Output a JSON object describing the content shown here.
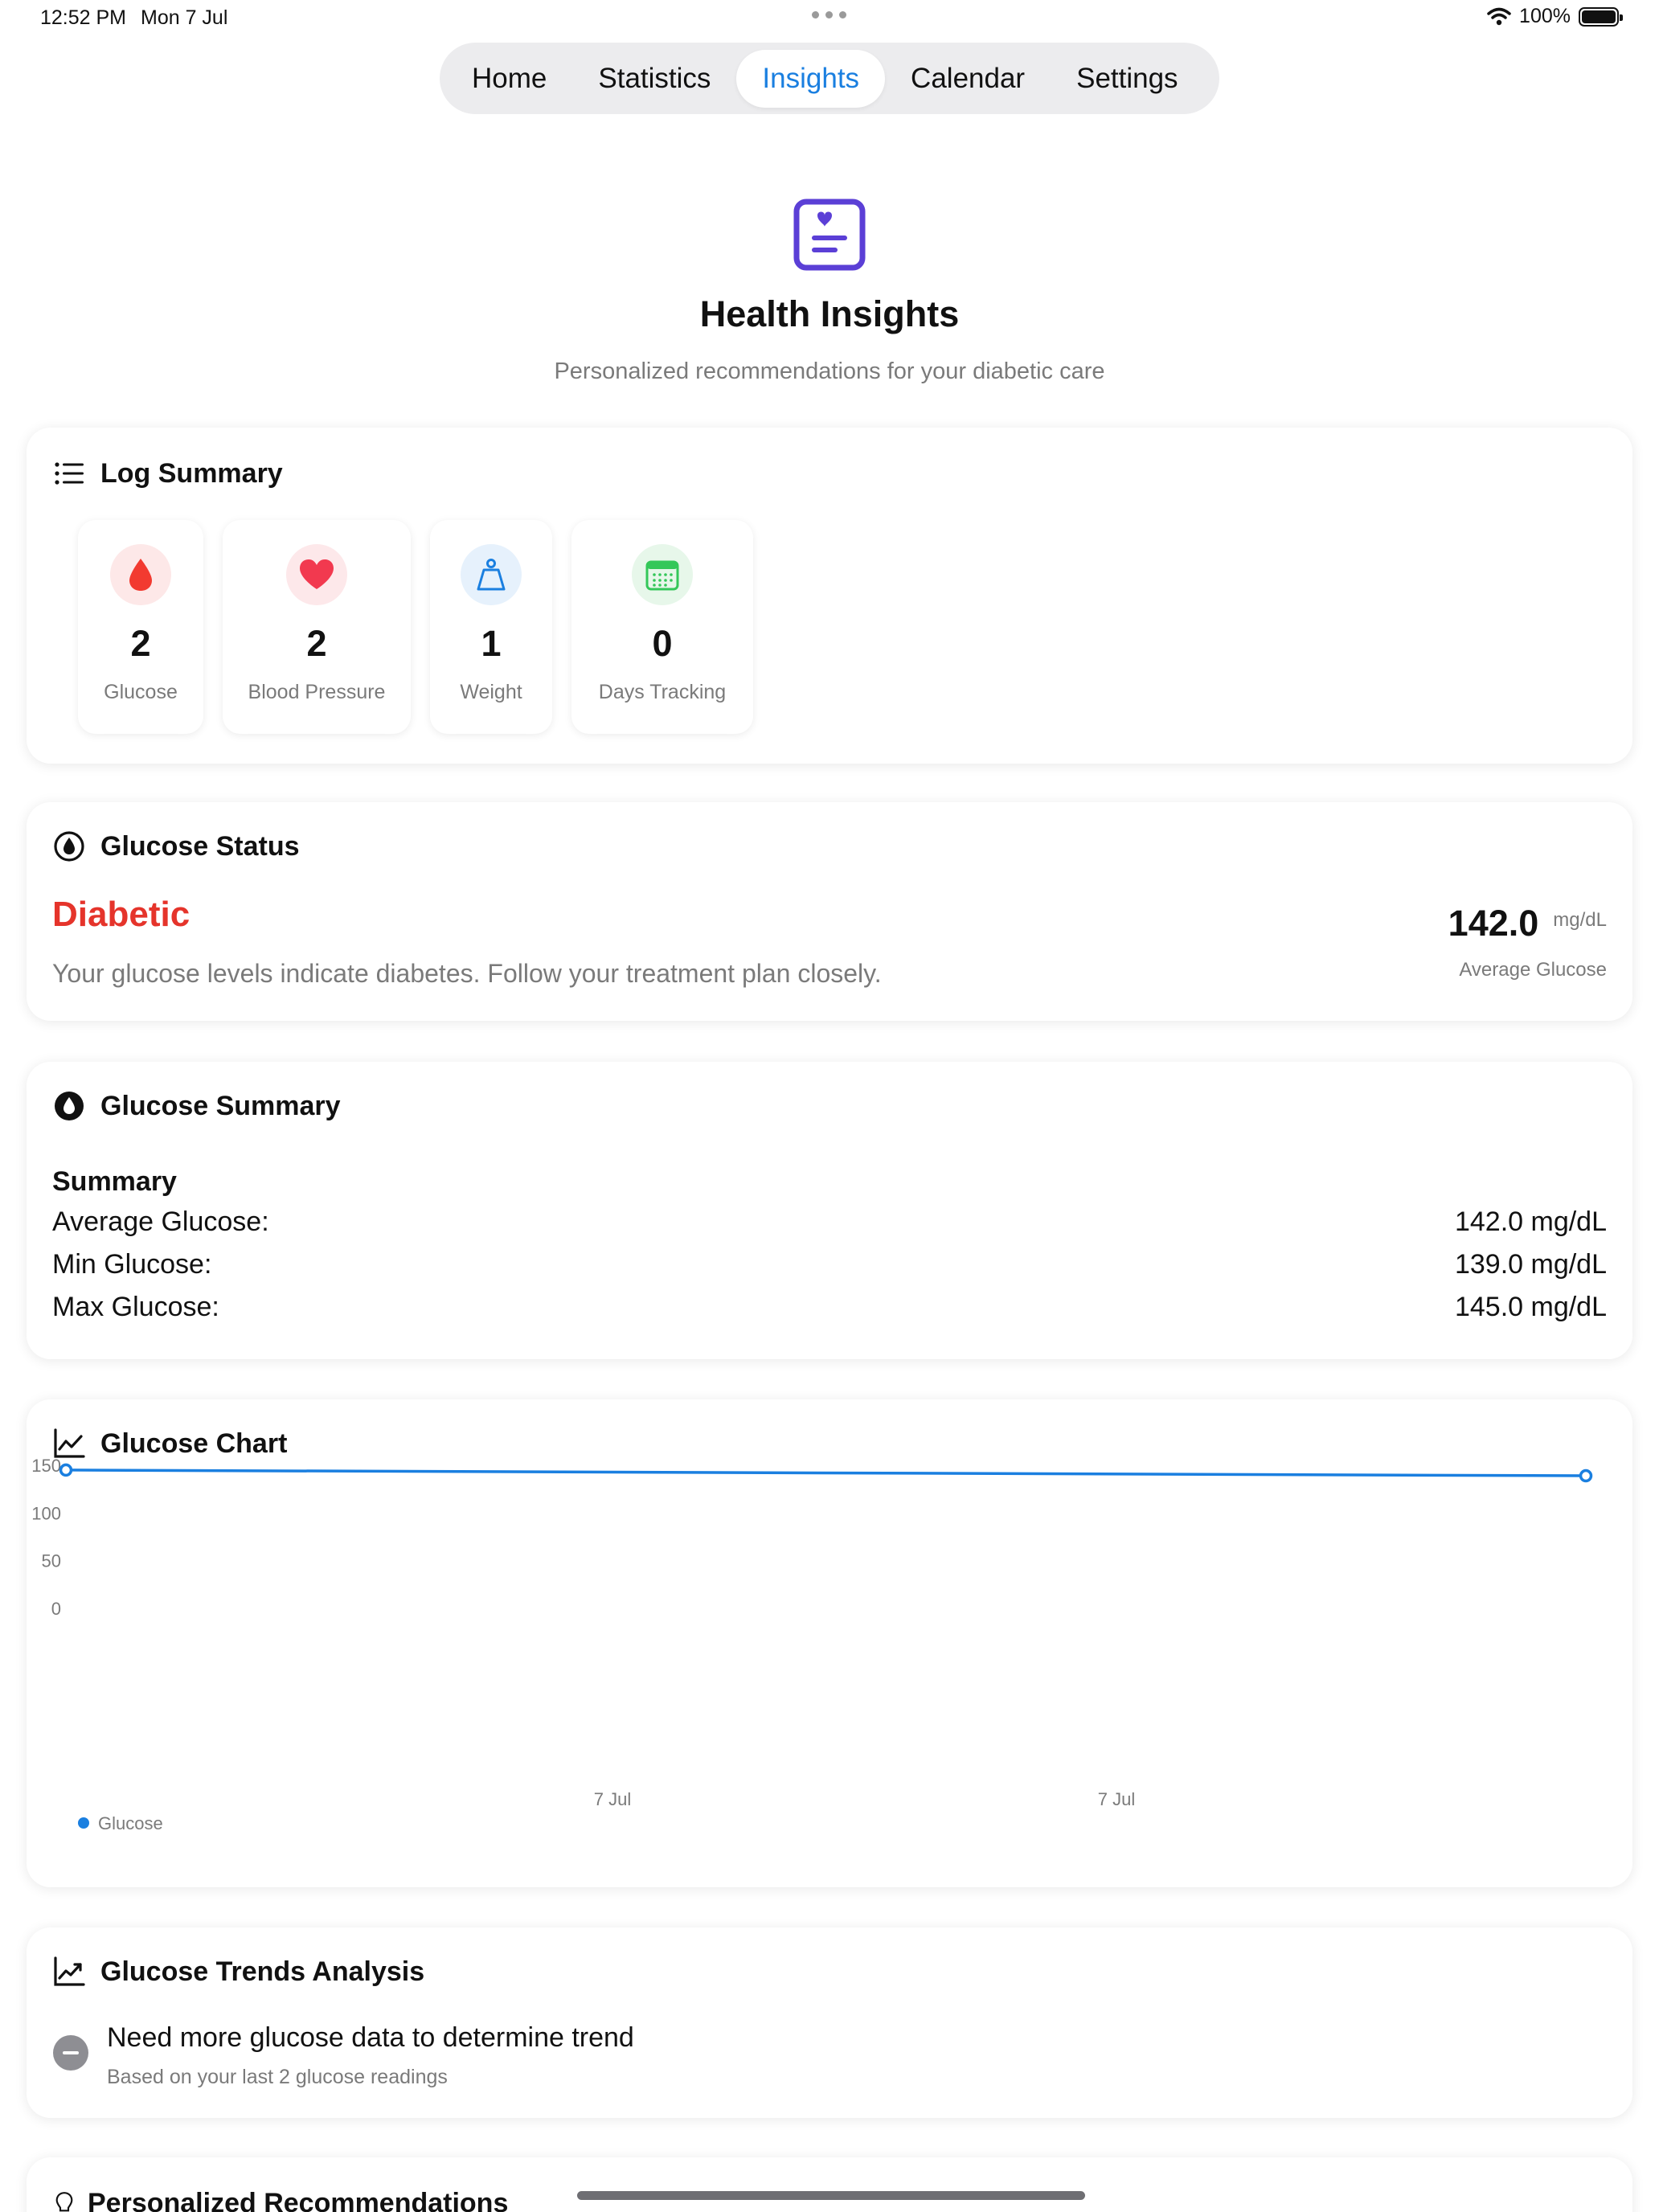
{
  "status_bar": {
    "time": "12:52 PM",
    "date": "Mon 7 Jul",
    "battery": "100%"
  },
  "tabs": [
    {
      "label": "Home",
      "active": false
    },
    {
      "label": "Statistics",
      "active": false
    },
    {
      "label": "Insights",
      "active": true
    },
    {
      "label": "Calendar",
      "active": false
    },
    {
      "label": "Settings",
      "active": false
    }
  ],
  "header": {
    "title": "Health Insights",
    "subtitle": "Personalized recommendations for your diabetic care"
  },
  "log_summary": {
    "title": "Log Summary",
    "tiles": [
      {
        "value": "2",
        "label": "Glucose",
        "icon": "blood-drop-icon",
        "color": "#f23a30",
        "bg": "#fde8e8"
      },
      {
        "value": "2",
        "label": "Blood Pressure",
        "icon": "heart-icon",
        "color": "#f2394f",
        "bg": "#fde8ea"
      },
      {
        "value": "1",
        "label": "Weight",
        "icon": "scale-icon",
        "color": "#1a7fe0",
        "bg": "#e6f1fc"
      },
      {
        "value": "0",
        "label": "Days Tracking",
        "icon": "calendar-icon",
        "color": "#34c759",
        "bg": "#e7f7ea"
      }
    ]
  },
  "glucose_status": {
    "title": "Glucose Status",
    "status": "Diabetic",
    "status_color": "#e5342b",
    "description": "Your glucose levels indicate diabetes. Follow your treatment plan closely.",
    "average_value": "142.0",
    "average_unit": "mg/dL",
    "average_label": "Average Glucose"
  },
  "glucose_summary": {
    "title": "Glucose Summary",
    "subtitle": "Summary",
    "rows": [
      {
        "label": "Average Glucose:",
        "value": "142.0 mg/dL"
      },
      {
        "label": "Min Glucose:",
        "value": "139.0 mg/dL"
      },
      {
        "label": "Max Glucose:",
        "value": "145.0 mg/dL"
      }
    ]
  },
  "glucose_chart": {
    "title": "Glucose Chart",
    "legend": "Glucose",
    "line_color": "#1a7fe0"
  },
  "chart_data": {
    "type": "line",
    "x": [
      "7 Jul",
      "7 Jul"
    ],
    "series": [
      {
        "name": "Glucose",
        "values": [
          145,
          139
        ]
      }
    ],
    "y_ticks": [
      0,
      50,
      100,
      150
    ],
    "x_tick_labels": [
      "7 Jul",
      "7 Jul"
    ],
    "ylim": [
      0,
      150
    ],
    "grid": false,
    "legend_position": "bottom-left"
  },
  "trends": {
    "title": "Glucose Trends Analysis",
    "message": "Need more glucose data to determine trend",
    "detail": "Based on your last 2 glucose readings"
  },
  "recommendations": {
    "title": "Personalized Recommendations"
  }
}
